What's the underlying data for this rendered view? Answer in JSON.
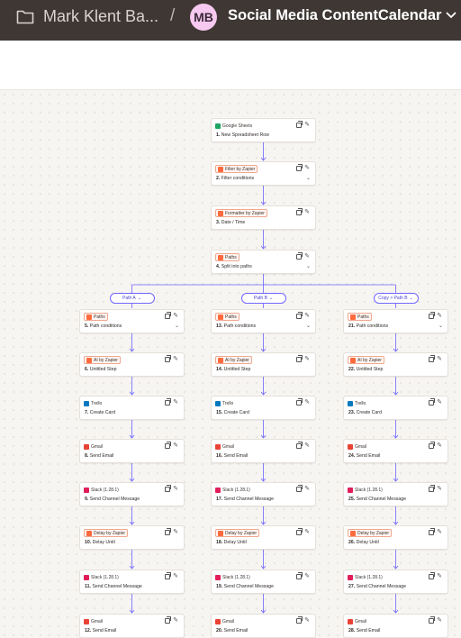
{
  "header": {
    "folder_name": "Mark Klent Ba...",
    "separator": "/",
    "avatar_initials": "MB",
    "zap_title": "Social Media ContentCalendar"
  },
  "colors": {
    "topbar": "#3e3733",
    "avatar": "#f7c9f0",
    "connector": "#6b63ff",
    "tag_border": "#f0a88f"
  },
  "trunk": [
    {
      "app": "Google Sheets",
      "icon": "google-sheets-icon",
      "num": "1.",
      "title": "New Spreadsheet Row",
      "tagged": false,
      "expandable": false
    },
    {
      "app": "Filter by Zapier",
      "icon": "filter-icon",
      "num": "2.",
      "title": "Filter conditions",
      "tagged": true,
      "expandable": true
    },
    {
      "app": "Formatter by Zapier",
      "icon": "formatter-icon",
      "num": "3.",
      "title": "Date / Time",
      "tagged": true,
      "expandable": false
    },
    {
      "app": "Paths",
      "icon": "paths-icon",
      "num": "4.",
      "title": "Split into paths",
      "tagged": true,
      "expandable": true
    }
  ],
  "branches": [
    {
      "label": "Path A",
      "steps": [
        {
          "app": "Paths",
          "icon": "paths-icon",
          "num": "5.",
          "title": "Path conditions",
          "tagged": true,
          "expandable": true
        },
        {
          "app": "AI by Zapier",
          "icon": "ai-icon",
          "num": "6.",
          "title": "Untitled Step",
          "tagged": true,
          "expandable": false
        },
        {
          "app": "Trello",
          "icon": "trello-icon",
          "num": "7.",
          "title": "Create Card",
          "tagged": false,
          "expandable": false
        },
        {
          "app": "Gmail",
          "icon": "gmail-icon",
          "num": "8.",
          "title": "Send Email",
          "tagged": false,
          "expandable": false
        },
        {
          "app": "Slack (1.28.1)",
          "icon": "slack-icon",
          "num": "9.",
          "title": "Send Channel Message",
          "tagged": false,
          "expandable": false
        },
        {
          "app": "Delay by Zapier",
          "icon": "delay-icon",
          "num": "10.",
          "title": "Delay Until",
          "tagged": true,
          "expandable": false
        },
        {
          "app": "Slack (1.28.1)",
          "icon": "slack-icon",
          "num": "11.",
          "title": "Send Channel Message",
          "tagged": false,
          "expandable": false
        },
        {
          "app": "Gmail",
          "icon": "gmail-icon",
          "num": "12.",
          "title": "Send Email",
          "tagged": false,
          "expandable": false
        }
      ]
    },
    {
      "label": "Path B",
      "steps": [
        {
          "app": "Paths",
          "icon": "paths-icon",
          "num": "13.",
          "title": "Path conditions",
          "tagged": true,
          "expandable": true
        },
        {
          "app": "AI by Zapier",
          "icon": "ai-icon",
          "num": "14.",
          "title": "Untitled Step",
          "tagged": true,
          "expandable": false
        },
        {
          "app": "Trello",
          "icon": "trello-icon",
          "num": "15.",
          "title": "Create Card",
          "tagged": false,
          "expandable": false
        },
        {
          "app": "Gmail",
          "icon": "gmail-icon",
          "num": "16.",
          "title": "Send Email",
          "tagged": false,
          "expandable": false
        },
        {
          "app": "Slack (1.28.1)",
          "icon": "slack-icon",
          "num": "17.",
          "title": "Send Channel Message",
          "tagged": false,
          "expandable": false
        },
        {
          "app": "Delay by Zapier",
          "icon": "delay-icon",
          "num": "18.",
          "title": "Delay Until",
          "tagged": true,
          "expandable": false
        },
        {
          "app": "Slack (1.28.1)",
          "icon": "slack-icon",
          "num": "19.",
          "title": "Send Channel Message",
          "tagged": false,
          "expandable": false
        },
        {
          "app": "Gmail",
          "icon": "gmail-icon",
          "num": "20.",
          "title": "Send Email",
          "tagged": false,
          "expandable": false
        }
      ]
    },
    {
      "label": "Copy > Path B",
      "steps": [
        {
          "app": "Paths",
          "icon": "paths-icon",
          "num": "21.",
          "title": "Path conditions",
          "tagged": true,
          "expandable": true
        },
        {
          "app": "AI by Zapier",
          "icon": "ai-icon",
          "num": "22.",
          "title": "Untitled Step",
          "tagged": true,
          "expandable": false
        },
        {
          "app": "Trello",
          "icon": "trello-icon",
          "num": "23.",
          "title": "Create Card",
          "tagged": false,
          "expandable": false
        },
        {
          "app": "Gmail",
          "icon": "gmail-icon",
          "num": "24.",
          "title": "Send Email",
          "tagged": false,
          "expandable": false
        },
        {
          "app": "Slack (1.28.1)",
          "icon": "slack-icon",
          "num": "25.",
          "title": "Send Channel Message",
          "tagged": false,
          "expandable": false
        },
        {
          "app": "Delay by Zapier",
          "icon": "delay-icon",
          "num": "26.",
          "title": "Delay Until",
          "tagged": true,
          "expandable": false
        },
        {
          "app": "Slack (1.28.1)",
          "icon": "slack-icon",
          "num": "27.",
          "title": "Send Channel Message",
          "tagged": false,
          "expandable": false
        },
        {
          "app": "Gmail",
          "icon": "gmail-icon",
          "num": "28.",
          "title": "Send Email",
          "tagged": false,
          "expandable": false
        }
      ]
    }
  ]
}
